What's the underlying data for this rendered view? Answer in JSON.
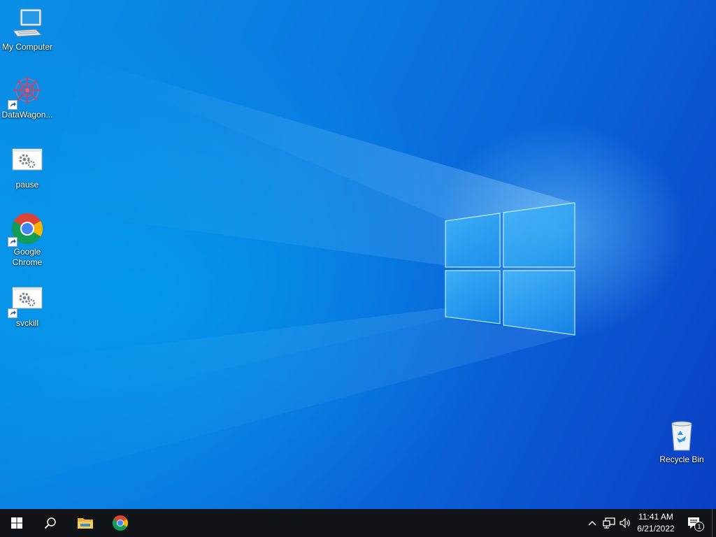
{
  "desktop": {
    "icons": [
      {
        "label": "My Computer",
        "icon": "computer-icon"
      },
      {
        "label": "DataWagon...",
        "icon": "datawagon-icon",
        "shortcut": true
      },
      {
        "label": "pause",
        "icon": "batch-file-icon"
      },
      {
        "label": "Google Chrome",
        "icon": "chrome-icon",
        "shortcut": true
      },
      {
        "label": "svckill",
        "icon": "batch-file-icon",
        "shortcut": true
      },
      {
        "label": "Recycle Bin",
        "icon": "recycle-bin-icon"
      }
    ]
  },
  "taskbar": {
    "start": "windows-start-icon",
    "search": "search-icon",
    "pinned": [
      "file-explorer-icon",
      "chrome-icon"
    ],
    "tray": [
      "chevron-up-icon",
      "network-icon",
      "volume-icon"
    ],
    "clock": {
      "time": "11:41 AM",
      "date": "6/21/2022"
    },
    "notifications": {
      "icon": "action-center-icon",
      "count": "1"
    }
  },
  "colors": {
    "taskbar": "#101318",
    "desktop_accent": "#0a78e0"
  }
}
